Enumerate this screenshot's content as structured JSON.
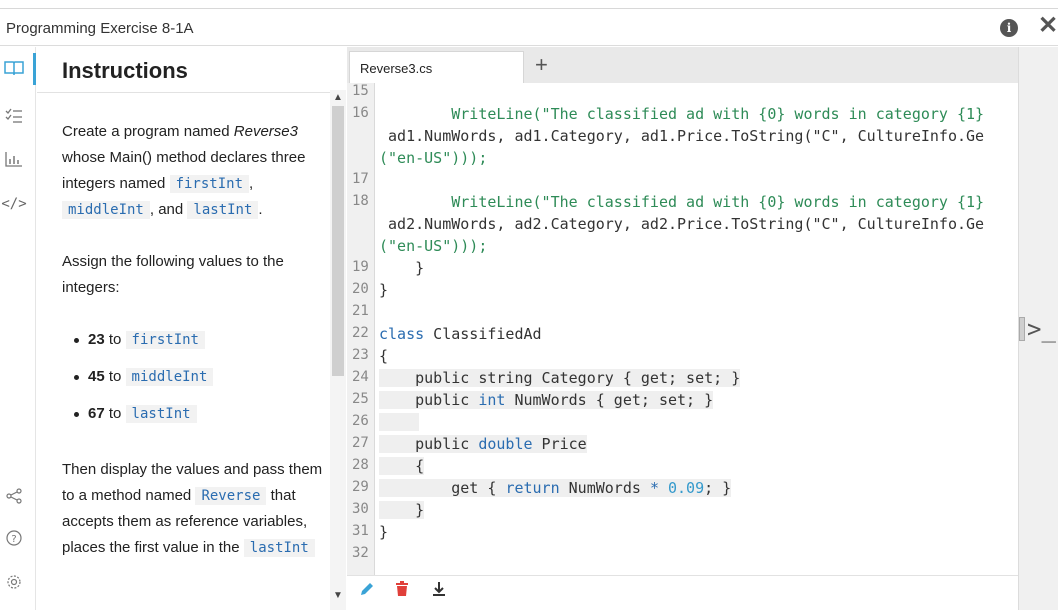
{
  "window": {
    "title": "Programming Exercise 8-1A"
  },
  "rail_icons": [
    "book-icon",
    "checklist-icon",
    "chart-icon",
    "code-icon",
    "share-icon",
    "help-icon",
    "settings-icon"
  ],
  "instructions": {
    "heading": "Instructions",
    "p1_a": "Create a program named",
    "p1_b": "Reverse3",
    "p1_c": "whose Main() method declares three integers named",
    "p1_first": "firstInt",
    "p1_comma": ",",
    "p1_middle": "middleInt",
    "p1_and": ", and",
    "p1_last": "lastInt",
    "p1_end": ".",
    "p2": "Assign the following values to the integers:",
    "items": [
      {
        "value": "23",
        "to": "to",
        "var": "firstInt"
      },
      {
        "value": "45",
        "to": "to",
        "var": "middleInt"
      },
      {
        "value": "67",
        "to": "to",
        "var": "lastInt"
      }
    ],
    "p3_a": "Then display the values and pass them to a method named",
    "p3_method": "Reverse",
    "p3_b": "that accepts them as reference variables, places the first value in the",
    "p3_var": "lastInt"
  },
  "editor": {
    "tab_label": "Reverse3.cs",
    "add_tab": "+",
    "line_numbers": [
      "15",
      "16",
      "17",
      "18",
      "19",
      "20",
      "21",
      "22",
      "23",
      "24",
      "25",
      "26",
      "27",
      "28",
      "29",
      "30",
      "31",
      "32"
    ],
    "code": {
      "l16a": "        WriteLine(\"The classified ad with {0} words in category {1}",
      "l16b": " ad1.NumWords, ad1.Category, ad1.Price.ToString(\"C\", CultureInfo.Ge",
      "l16c": "(\"en-US\")));",
      "l18a": "        WriteLine(\"The classified ad with {0} words in category {1}",
      "l18b": " ad2.NumWords, ad2.Category, ad2.Price.ToString(\"C\", CultureInfo.Ge",
      "l18c": "(\"en-US\")));",
      "l19": "    }",
      "l20": "}",
      "l22_kw": "class",
      "l22_name": " ClassifiedAd",
      "l23": "{",
      "l24": "    public string Category { get; set; }",
      "l25_a": "    public ",
      "l25_kw": "int",
      "l25_b": " NumWords { get; set; }",
      "l27_a": "    public ",
      "l27_kw": "double",
      "l27_b": " Price",
      "l28": "    {",
      "l29_a": "        get { ",
      "l29_kw": "return",
      "l29_b": " NumWords ",
      "l29_op": "*",
      "l29_num": " 0.09",
      "l29_c": "; }",
      "l30": "    }",
      "l31": "}"
    }
  },
  "footer_icons": [
    "pencil-icon",
    "trash-icon",
    "download-icon"
  ],
  "colors": {
    "accent": "#3aa3d6",
    "keyword": "#2a6cb0",
    "string": "#2e8b57",
    "delete": "#e0403a"
  }
}
